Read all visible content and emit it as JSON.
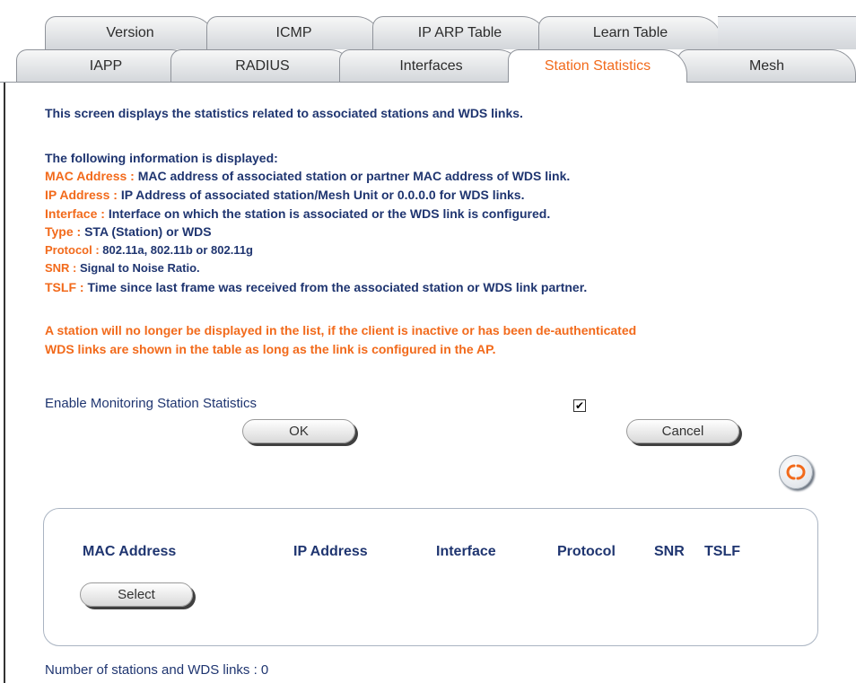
{
  "tabs": {
    "row1": [
      "Version",
      "ICMP",
      "IP ARP Table",
      "Learn Table"
    ],
    "row2": [
      "IAPP",
      "RADIUS",
      "Interfaces",
      "Station Statistics",
      "Mesh"
    ],
    "active": "Station Statistics"
  },
  "intro": "This screen displays the statistics related to associated stations and WDS links.",
  "info_heading": "The following information is displayed:",
  "info_items": [
    {
      "label": "MAC Address :",
      "text": "MAC address of associated station or partner MAC address of WDS link."
    },
    {
      "label": "IP Address :",
      "text": "IP Address of associated station/Mesh Unit or 0.0.0.0 for WDS links."
    },
    {
      "label": "Interface :",
      "text": "Interface on which the station is associated or the WDS link is configured."
    },
    {
      "label": "Type :",
      "text": "STA (Station) or WDS"
    },
    {
      "label": "Protocol :",
      "text": "802.11a, 802.11b or 802.11g"
    },
    {
      "label": "SNR :",
      "text": "Signal to Noise Ratio."
    },
    {
      "label": "TSLF :",
      "text": "Time since last frame was received from the associated station or WDS link partner."
    }
  ],
  "notes": [
    "A station will no longer be displayed in the list, if the client is inactive or has been de-authenticated",
    "WDS links are shown in the table as long as the link is configured in the AP."
  ],
  "monitoring": {
    "label": "Enable Monitoring Station Statistics",
    "checked": true,
    "check_glyph": "✔"
  },
  "buttons": {
    "ok": "OK",
    "cancel": "Cancel",
    "select": "Select"
  },
  "table": {
    "headers": [
      "MAC Address",
      "IP Address",
      "Interface",
      "Protocol",
      "SNR",
      "TSLF"
    ]
  },
  "footer": "Number of stations and WDS links : 0",
  "colors": {
    "accent": "#f26a1b",
    "text": "#1f3570"
  },
  "icons": {
    "refresh": "refresh-icon"
  }
}
